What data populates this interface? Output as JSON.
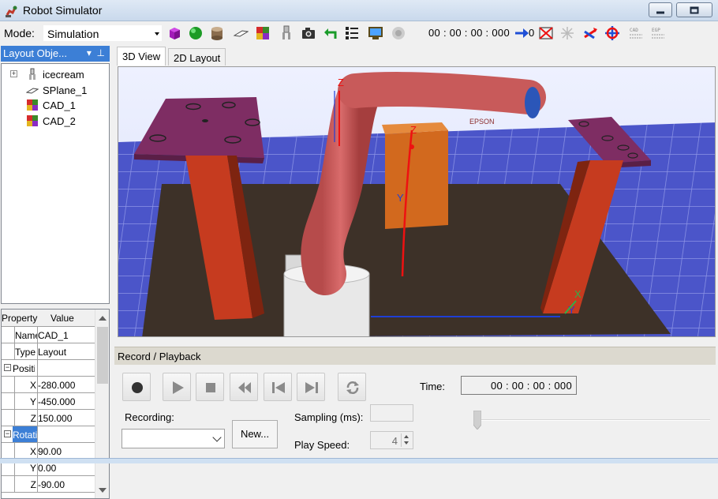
{
  "window": {
    "title": "Robot Simulator"
  },
  "toolbar": {
    "mode_label": "Mode:",
    "mode_value": "Simulation",
    "time_readout": "00 : 00 : 00 : 000",
    "zero_count": "0",
    "icons": [
      "purple-box-icon",
      "green-sphere-icon",
      "cylinder-icon",
      "plane-icon",
      "cad-part-icon",
      "gripper-icon",
      "camera-icon",
      "undo-arrow-icon",
      "layout-list-icon",
      "monitor-icon",
      "disabled-part-icon",
      "arrow-counter-icon",
      "collision-icon",
      "collision-disabled-icon",
      "axes-icon",
      "move-axes-icon",
      "cad-to-point-icon",
      "egp-icon"
    ]
  },
  "left_pane": {
    "header": "Layout Obje...",
    "tree": [
      {
        "label": "icecream",
        "icon": "robot-icon",
        "expandable": true
      },
      {
        "label": "SPlane_1",
        "icon": "plane-icon"
      },
      {
        "label": "CAD_1",
        "icon": "cad-part-icon"
      },
      {
        "label": "CAD_2",
        "icon": "cad-part-icon"
      }
    ]
  },
  "properties": {
    "header_property": "Property",
    "header_value": "Value",
    "rows": [
      {
        "key": "Name",
        "value": "CAD_1"
      },
      {
        "key": "Type",
        "value": "Layout"
      },
      {
        "key": "Position",
        "value": ""
      },
      {
        "key": "X",
        "value": "-280.000"
      },
      {
        "key": "Y",
        "value": "-450.000"
      },
      {
        "key": "Z",
        "value": "150.000"
      },
      {
        "key": "Rotation",
        "value": ""
      },
      {
        "key": "X",
        "value": "90.00"
      },
      {
        "key": "Y",
        "value": "0.00"
      },
      {
        "key": "Z",
        "value": "-90.00"
      }
    ]
  },
  "tabs": [
    "3D View",
    "2D Layout"
  ],
  "scene": {
    "label_z_left": "Z",
    "label_z_mid": "Z",
    "label_y_mid": "Y",
    "label_x_right": "X",
    "label_y_right": "Y",
    "robot_brand": "EPSON"
  },
  "record_playback": {
    "header": "Record / Playback",
    "time_label": "Time:",
    "time_value": "00 : 00 : 00 : 000",
    "recording_label": "Recording:",
    "new_button": "New...",
    "sampling_label": "Sampling (ms):",
    "sampling_value": "",
    "play_speed_label": "Play Speed:",
    "play_speed_value": "4"
  }
}
